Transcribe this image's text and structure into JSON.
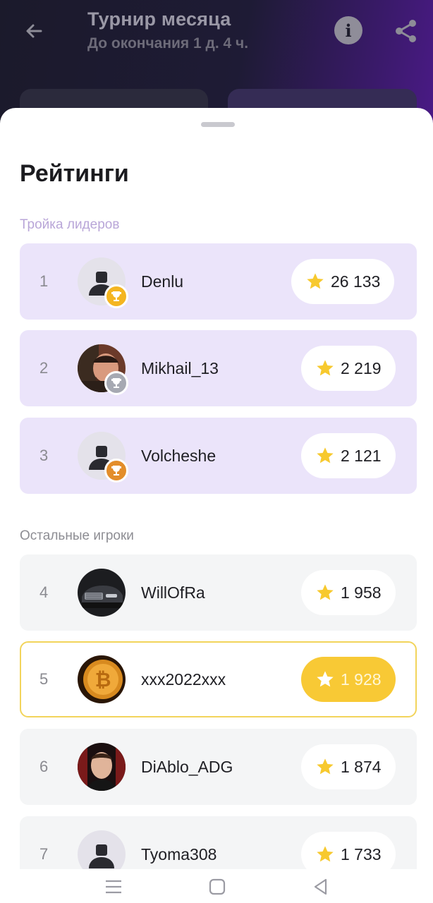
{
  "header": {
    "title": "Турнир месяца",
    "subtitle": "До окончания 1 д. 4 ч.",
    "icons": {
      "back": "arrow-left-icon",
      "info": "info-icon",
      "share": "share-icon"
    },
    "info_glyph": "i"
  },
  "sheet": {
    "title": "Рейтинги",
    "section_top": "Тройка лидеров",
    "section_rest": "Остальные игроки"
  },
  "leaders": [
    {
      "rank": "1",
      "name": "Denlu",
      "score": "26 133",
      "trophy": "gold",
      "avatar": "default"
    },
    {
      "rank": "2",
      "name": "Mikhail_13",
      "score": "2 219",
      "trophy": "silver",
      "avatar": "photo"
    },
    {
      "rank": "3",
      "name": "Volcheshe",
      "score": "2 121",
      "trophy": "bronze",
      "avatar": "default"
    }
  ],
  "players": [
    {
      "rank": "4",
      "name": "WillOfRa",
      "score": "1 958",
      "avatar": "car"
    },
    {
      "rank": "5",
      "name": "xxx2022xxx",
      "score": "1 928",
      "avatar": "bitcoin",
      "current_user": true
    },
    {
      "rank": "6",
      "name": "DiAblo_ADG",
      "score": "1 874",
      "avatar": "photo"
    },
    {
      "rank": "7",
      "name": "Tyoma308",
      "score": "1 733",
      "avatar": "default"
    }
  ],
  "colors": {
    "leader_row": "#ebe4fa",
    "other_row": "#f4f5f6",
    "highlight_border": "#f2d45b",
    "star": "#f7c92e",
    "gold": "#f4b521",
    "silver": "#a6a9b2",
    "bronze": "#e38d2b"
  },
  "system_nav": [
    "menu-icon",
    "home-icon",
    "back-triangle-icon"
  ]
}
